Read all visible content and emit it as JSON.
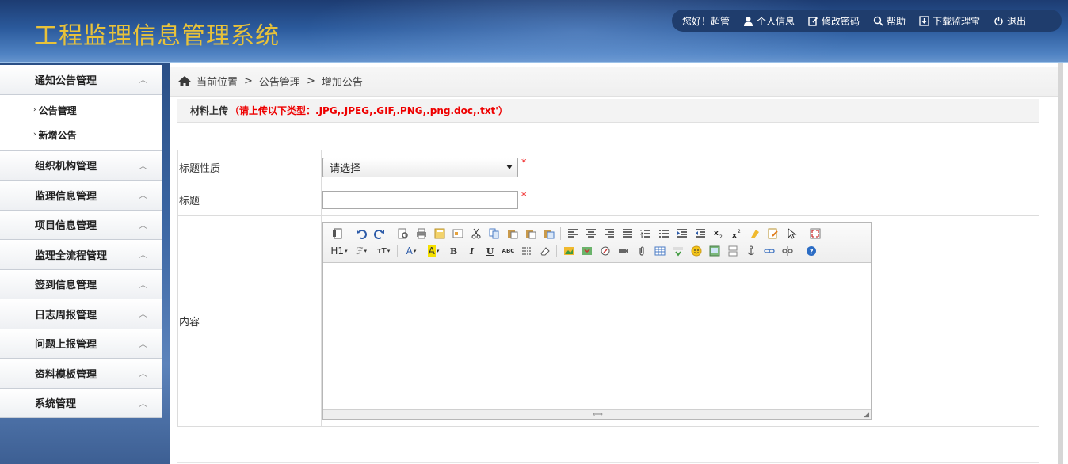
{
  "header": {
    "app_title": "工程监理信息管理系统",
    "greeting": "您好！超管",
    "nav": [
      {
        "label": "个人信息",
        "icon": "user-icon"
      },
      {
        "label": "修改密码",
        "icon": "edit-icon"
      },
      {
        "label": "帮助",
        "icon": "search-icon"
      },
      {
        "label": "下载监理宝",
        "icon": "download-icon"
      },
      {
        "label": "退出",
        "icon": "power-icon"
      }
    ]
  },
  "sidebar": {
    "menus": [
      {
        "label": "通知公告管理",
        "chevron": "︿",
        "children": [
          {
            "label": "公告管理"
          },
          {
            "label": "新增公告"
          }
        ]
      },
      {
        "label": "组织机构管理",
        "chevron": "︿"
      },
      {
        "label": "监理信息管理",
        "chevron": "︿"
      },
      {
        "label": "项目信息管理",
        "chevron": "︿"
      },
      {
        "label": "监理全流程管理",
        "chevron": "︿"
      },
      {
        "label": "签到信息管理",
        "chevron": "︿"
      },
      {
        "label": "日志周报管理",
        "chevron": "︿"
      },
      {
        "label": "问题上报管理",
        "chevron": "︿"
      },
      {
        "label": "资料模板管理",
        "chevron": "︿"
      },
      {
        "label": "系统管理",
        "chevron": "︿"
      }
    ],
    "sub_arrow": "›"
  },
  "breadcrumb": {
    "current": "当前位置",
    "sep": ">",
    "level1": "公告管理",
    "level2": "增加公告"
  },
  "section": {
    "label": "材料上传",
    "hint": "（请上传以下类型：.JPG,.JPEG,.GIF,.PNG,.png.doc,.txt'）"
  },
  "form": {
    "type_label": "标题性质",
    "type_value": "请选择",
    "title_label": "标题",
    "title_value": "",
    "content_label": "内容",
    "required_mark": "*"
  },
  "editor": {
    "row2_labels": {
      "heading": "H1",
      "font": "ℱ",
      "size": "тT",
      "font_color": "A",
      "bg_color": "A",
      "bold": "B",
      "italic": "I",
      "underline": "U",
      "strike": "ABC"
    },
    "status_grip": "⟺",
    "resize_grip": "◢"
  }
}
